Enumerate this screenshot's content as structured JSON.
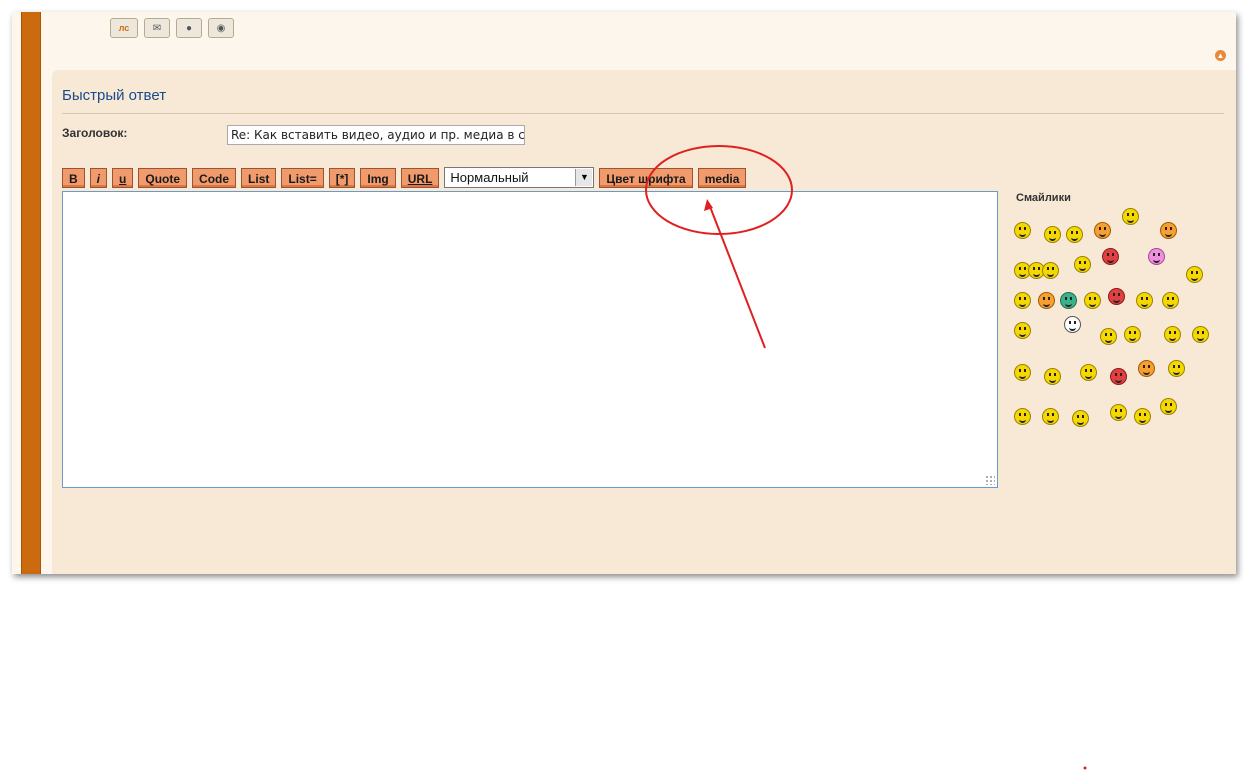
{
  "profile_icons": [
    {
      "name": "profile-icon",
      "label": "лс"
    },
    {
      "name": "email-icon",
      "label": "✉"
    },
    {
      "name": "website-icon",
      "label": "●"
    },
    {
      "name": "camera-icon",
      "label": "◉"
    }
  ],
  "quick_reply": {
    "title": "Быстрый ответ",
    "subject_label": "Заголовок:",
    "subject_value": "Re: Как вставить видео, аудио и пр. медиа в со"
  },
  "toolbar": {
    "buttons": [
      {
        "label": "B",
        "name": "bold-button",
        "style": "plain"
      },
      {
        "label": "i",
        "name": "italic-button",
        "style": "italic"
      },
      {
        "label": "u",
        "name": "underline-button",
        "style": "underline"
      },
      {
        "label": "Quote",
        "name": "quote-button",
        "style": "plain"
      },
      {
        "label": "Code",
        "name": "code-button",
        "style": "plain"
      },
      {
        "label": "List",
        "name": "list-button",
        "style": "plain"
      },
      {
        "label": "List=",
        "name": "list-ordered-button",
        "style": "plain"
      },
      {
        "label": "[*]",
        "name": "list-item-button",
        "style": "plain"
      },
      {
        "label": "Img",
        "name": "img-button",
        "style": "plain"
      },
      {
        "label": "URL",
        "name": "url-button",
        "style": "underline"
      }
    ],
    "font_size_select": "Нормальный",
    "font_color_label": "Цвет шрифта",
    "media_label": "media"
  },
  "smilies": {
    "label": "Смайлики",
    "count": 38
  },
  "colors": {
    "accent": "#cc6a10",
    "button_bg": "#f19a6c",
    "title_blue": "#1a4a8c",
    "annotation_red": "#e02020"
  }
}
